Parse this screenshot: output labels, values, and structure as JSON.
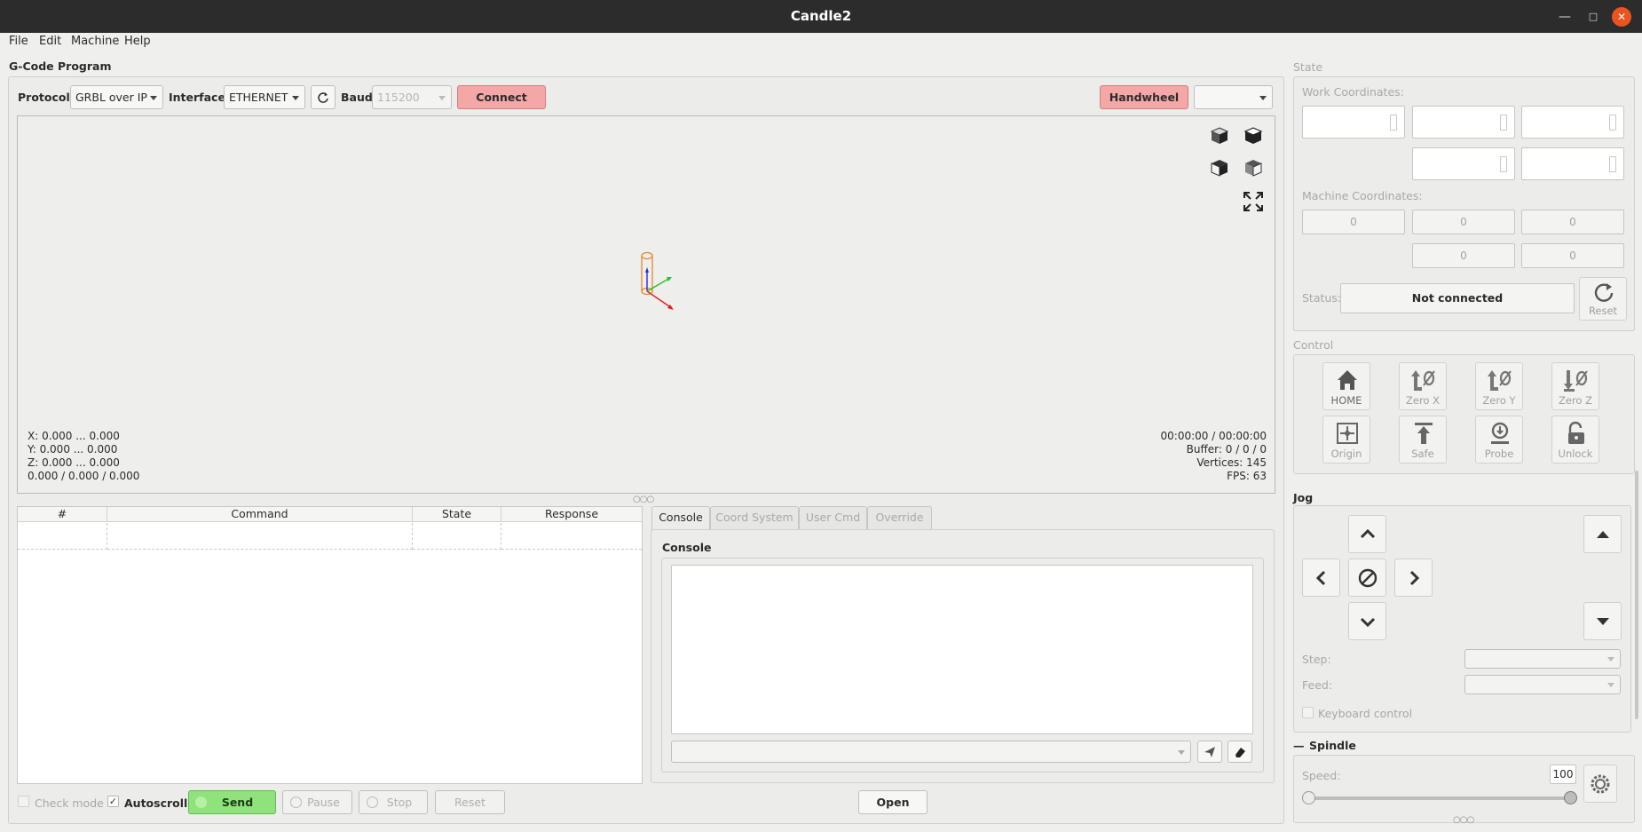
{
  "window": {
    "title": "Candle2"
  },
  "menu": [
    "File",
    "Edit",
    "Machine",
    "Help"
  ],
  "program": {
    "group_title": "G-Code Program",
    "protocol_label": "Protocol:",
    "protocol_value": "GRBL over IP",
    "interface_label": "Interface:",
    "interface_value": "ETHERNET",
    "baud_label": "Baud",
    "baud_value": "115200",
    "connect_label": "Connect",
    "handwheel_label": "Handwheel",
    "handwheel_combo_value": ""
  },
  "viewport": {
    "info_left": [
      "X: 0.000 ... 0.000",
      "Y: 0.000 ... 0.000",
      "Z: 0.000 ... 0.000",
      "0.000 / 0.000 / 0.000"
    ],
    "info_right": [
      "00:00:00 / 00:00:00",
      "Buffer: 0 / 0 / 0",
      "Vertices: 145",
      "FPS: 63"
    ]
  },
  "table": {
    "columns": [
      "#",
      "Command",
      "State",
      "Response"
    ]
  },
  "tabs": [
    "Console",
    "Coord System",
    "User Cmd",
    "Override"
  ],
  "console": {
    "title": "Console",
    "input_value": ""
  },
  "bottom": {
    "check_mode": "Check mode",
    "autoscroll": "Autoscroll",
    "autoscroll_checked": true,
    "send": "Send",
    "pause": "Pause",
    "stop": "Stop",
    "reset": "Reset",
    "open": "Open"
  },
  "state": {
    "title": "State",
    "work_label": "Work Coordinates:",
    "machine_label": "Machine Coordinates:",
    "machine_values": [
      "0",
      "0",
      "0",
      "0",
      "0"
    ],
    "status_label": "Status:",
    "status_value": "Not connected",
    "reset_label": "Reset"
  },
  "control": {
    "title": "Control",
    "buttons": [
      "HOME",
      "Zero X",
      "Zero Y",
      "Zero Z",
      "Origin",
      "Safe",
      "Probe",
      "Unlock"
    ]
  },
  "jog": {
    "title": "Jog",
    "step_label": "Step:",
    "feed_label": "Feed:",
    "keyboard_label": "Keyboard control"
  },
  "spindle": {
    "title": "Spindle",
    "speed_label": "Speed:",
    "speed_value": "100"
  },
  "colors": {
    "connect_bg": "#f3a7a7",
    "send_bg": "#8fe27c",
    "titlebar": "#2c2c2c",
    "close": "#e95420"
  }
}
